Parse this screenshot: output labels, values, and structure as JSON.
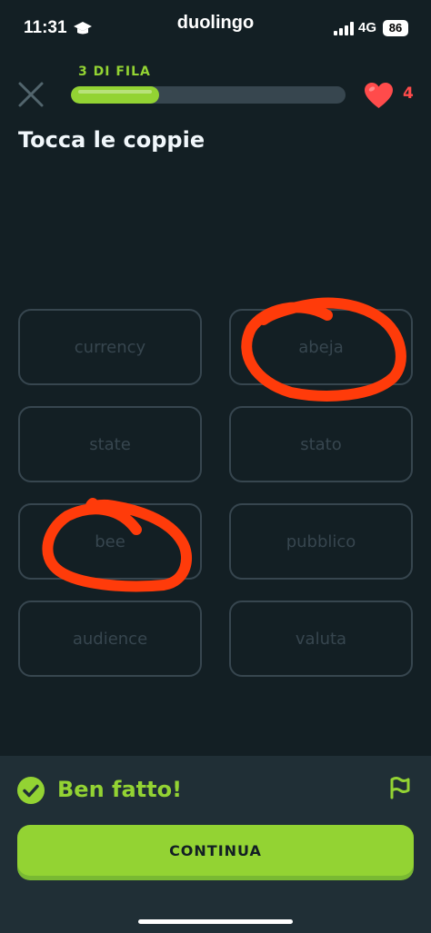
{
  "status_bar": {
    "time": "11:31",
    "app_name": "duolingo",
    "network": "4G",
    "battery": "86"
  },
  "lesson": {
    "streak_label": "3 DI FILA",
    "progress_fraction": 0.32,
    "hearts": "4",
    "prompt": "Tocca le coppie"
  },
  "tiles": [
    "currency",
    "abeja",
    "state",
    "stato",
    "bee",
    "pubblico",
    "audience",
    "valuta"
  ],
  "feedback": {
    "message": "Ben fatto!",
    "continue_label": "CONTINUA"
  },
  "colors": {
    "background": "#131f24",
    "accent_green": "#93d333",
    "heart_red": "#ff4b4b",
    "tile_border": "#37464f",
    "annotation": "#ff3b0a"
  }
}
